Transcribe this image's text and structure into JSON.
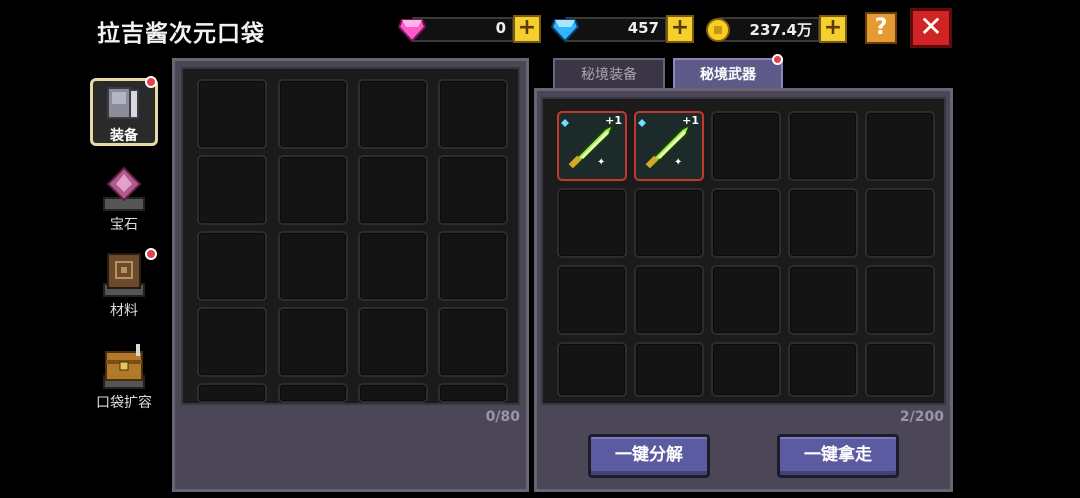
{
  "header": {
    "title": "拉吉酱次元口袋",
    "pink_gems": "0",
    "blue_gems": "457",
    "gold": "237.4万",
    "plus_symbol": "+",
    "help_symbol": "?",
    "close_symbol": "✕"
  },
  "sidebar": {
    "items": [
      {
        "label": "装备",
        "active": true,
        "badge": true,
        "icon": "armor-icon"
      },
      {
        "label": "宝石",
        "active": false,
        "badge": false,
        "icon": "gem-icon"
      },
      {
        "label": "材料",
        "active": false,
        "badge": true,
        "icon": "material-book-icon"
      },
      {
        "label": "口袋扩容",
        "active": false,
        "badge": false,
        "icon": "chest-icon"
      }
    ]
  },
  "left_panel": {
    "count": "0/80"
  },
  "right_panel": {
    "tabs": [
      {
        "label": "秘境装备",
        "active": false
      },
      {
        "label": "秘境武器",
        "active": true
      }
    ],
    "count": "2/200",
    "items": [
      {
        "name": "weapon-item",
        "level": "+1"
      },
      {
        "name": "weapon-item",
        "level": "+1"
      }
    ],
    "decompose_label": "一键分解",
    "take_all_label": "一键拿走"
  },
  "colors": {
    "accent_purple": "#5c5aa0",
    "close_red": "#d02424",
    "plus_yellow": "#f4cf2e",
    "rarity_red": "#c0392b"
  }
}
